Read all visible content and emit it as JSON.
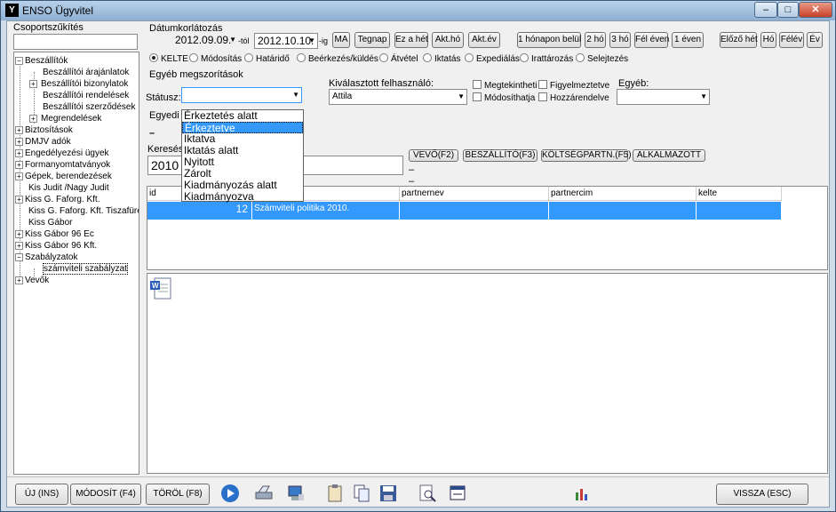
{
  "window": {
    "title": "ENSO Ügyvitel",
    "logo": "Y",
    "min": "–",
    "max": "□",
    "close": "✕"
  },
  "left": {
    "group_label": "Csoportszűkítés",
    "tree": [
      {
        "label": "Beszállítók",
        "expander": "−"
      },
      {
        "label": "Beszállítói árajánlatok"
      },
      {
        "label": "Beszállítói bizonylatok",
        "expander": "+"
      },
      {
        "label": "Beszállítói rendelések"
      },
      {
        "label": "Beszállítói szerződések"
      },
      {
        "label": "Megrendelések",
        "expander": "+"
      },
      {
        "label": "Biztosítások",
        "expander": "+"
      },
      {
        "label": "DMJV adók",
        "expander": "+"
      },
      {
        "label": "Engedélyezési ügyek",
        "expander": "+"
      },
      {
        "label": "Formanyomtatványok",
        "expander": "+"
      },
      {
        "label": "Gépek, berendezések",
        "expander": "+"
      },
      {
        "label": "Kis Judit /Nagy Judit"
      },
      {
        "label": "Kiss G. Faforg. Kft.",
        "expander": "+"
      },
      {
        "label": "Kiss G. Faforg. Kft. Tiszafüred"
      },
      {
        "label": "Kiss Gábor"
      },
      {
        "label": "Kiss Gábor 96 Ec",
        "expander": "+"
      },
      {
        "label": "Kiss Gábor 96 Kft.",
        "expander": "+"
      },
      {
        "label": "Szabályzatok",
        "expander": "−"
      },
      {
        "label": "számviteli szabályzat"
      },
      {
        "label": "Vevők",
        "expander": "+"
      }
    ]
  },
  "date": {
    "label": "Dátumkorlátozás",
    "from": "2012.09.09.",
    "from_suffix": "-tól",
    "to": "2012.10.10.",
    "to_suffix": "-ig",
    "buttons": [
      "MA",
      "Tegnap",
      "Ez a hét",
      "Akt.hó",
      "Akt.év",
      "1 hónapon belül",
      "2 hó",
      "3 hó",
      "Fél éven",
      "1 éven",
      "Előző hét",
      "Hó",
      "Félév",
      "Év"
    ]
  },
  "radios": [
    "KELTE",
    "Módosítás",
    "Határidő",
    "Beérkezés/küldés",
    "Átvétel",
    "Iktatás",
    "Expediálás",
    "Irattározás",
    "Selejtezés"
  ],
  "filters": {
    "other_label": "Egyéb megszorítások",
    "status_label": "Státusz:",
    "user_label": "Kiválasztott felhasználó:",
    "user_value": "Attila",
    "checks": [
      "Megtekintheti",
      "Módosíthatja",
      "Figyelmeztetve",
      "Hozzárendelve"
    ],
    "egyeb_label": "Egyéb:",
    "individual_label": "Egyedi m",
    "dash": "–"
  },
  "dropdown": {
    "options": [
      "Érkeztetés alatt",
      "Érkeztetve",
      "Iktatva",
      "Iktatás alatt",
      "Nyitott",
      "Zárolt",
      "Kiadmányozás alatt",
      "Kiadmányozva"
    ],
    "highlighted": 1
  },
  "search": {
    "label": "Keresés",
    "value": "2010 l",
    "buttons": [
      "VEVŐ(F2)",
      "BESZÁLLÍTÓ(F3)",
      "KÖLTSÉGPARTN.(F5)",
      "ALKALMAZOTT"
    ],
    "dash": "–"
  },
  "grid": {
    "columns": [
      "id",
      "partnernev",
      "partnercim",
      "kelte"
    ],
    "rows": [
      {
        "id": "12",
        "name": "Számviteli politika 2010.",
        "partnernev": "",
        "partnercim": "",
        "kelte": ""
      }
    ]
  },
  "bottom": {
    "new": "ÚJ (INS)",
    "modify": "MÓDOSÍT (F4)",
    "delete": "TÖRÖL (F8)",
    "back": "VISSZA (ESC)"
  },
  "colors": {
    "selection": "#3399ff",
    "titlebar": "#8eb0d3"
  }
}
